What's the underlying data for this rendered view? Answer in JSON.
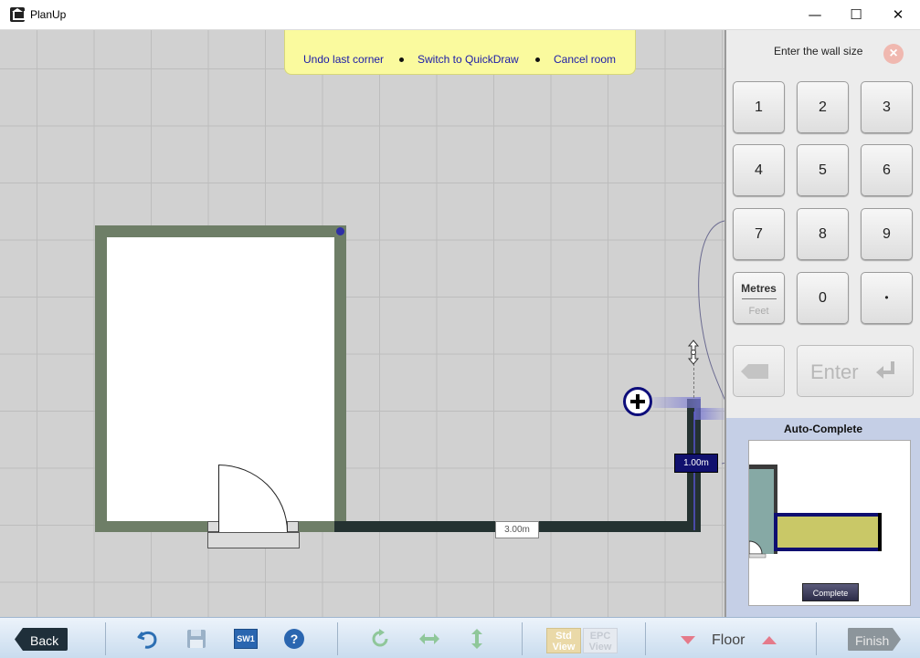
{
  "window": {
    "title": "PlanUp",
    "minimize_glyph": "—",
    "maximize_glyph": "☐",
    "close_glyph": "✕"
  },
  "hint_bar": {
    "undo": "Undo last corner",
    "quickdraw": "Switch to QuickDraw",
    "cancel": "Cancel room"
  },
  "canvas": {
    "wall_length_bottom": "3.00m",
    "wall_length_current": "1.00m"
  },
  "keypad": {
    "title": "Enter the wall size",
    "close_glyph": "×",
    "keys": [
      "1",
      "2",
      "3",
      "4",
      "5",
      "6",
      "7",
      "8",
      "9",
      "0",
      "•"
    ],
    "unit_primary": "Metres",
    "unit_secondary": "Feet",
    "enter_label": "Enter"
  },
  "autocomplete": {
    "title": "Auto-Complete",
    "complete_label": "Complete"
  },
  "toolbar": {
    "back_label": "Back",
    "finish_label": "Finish",
    "sw1_label": "SW1",
    "std_view_label_1": "Std",
    "std_view_label_2": "View",
    "epc_view_label_1": "EPC",
    "epc_view_label_2": "View",
    "floor_label": "Floor"
  },
  "colors": {
    "room_wall": "#6e7e67",
    "new_wall": "#243231",
    "hint_bar": "#fafa9e",
    "link": "#1a1aa8",
    "toolbar_accent": "#2c8ac9"
  }
}
